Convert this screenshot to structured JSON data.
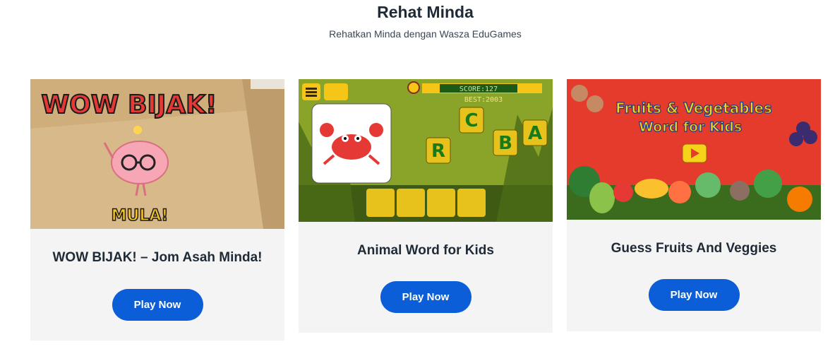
{
  "header": {
    "title": "Rehat Minda",
    "subtitle": "Rehatkan Minda dengan Wasza EduGames"
  },
  "cards": [
    {
      "title": "WOW BIJAK! – Jom Asah Minda!",
      "button": "Play Now",
      "art_heading": "WOW BIJAK!",
      "art_start": "MULA!"
    },
    {
      "title": "Animal Word for Kids",
      "button": "Play Now",
      "art_score": "SCORE:127",
      "art_best": "BEST:2003",
      "art_tiles": [
        "C",
        "R",
        "B",
        "A"
      ]
    },
    {
      "title": "Guess Fruits And Veggies",
      "button": "Play Now",
      "art_heading_line1": "Fruits & Vegetables",
      "art_heading_line2": "Word for Kids"
    }
  ],
  "colors": {
    "button": "#0b5ed7",
    "card_background": "#f4f4f5"
  }
}
